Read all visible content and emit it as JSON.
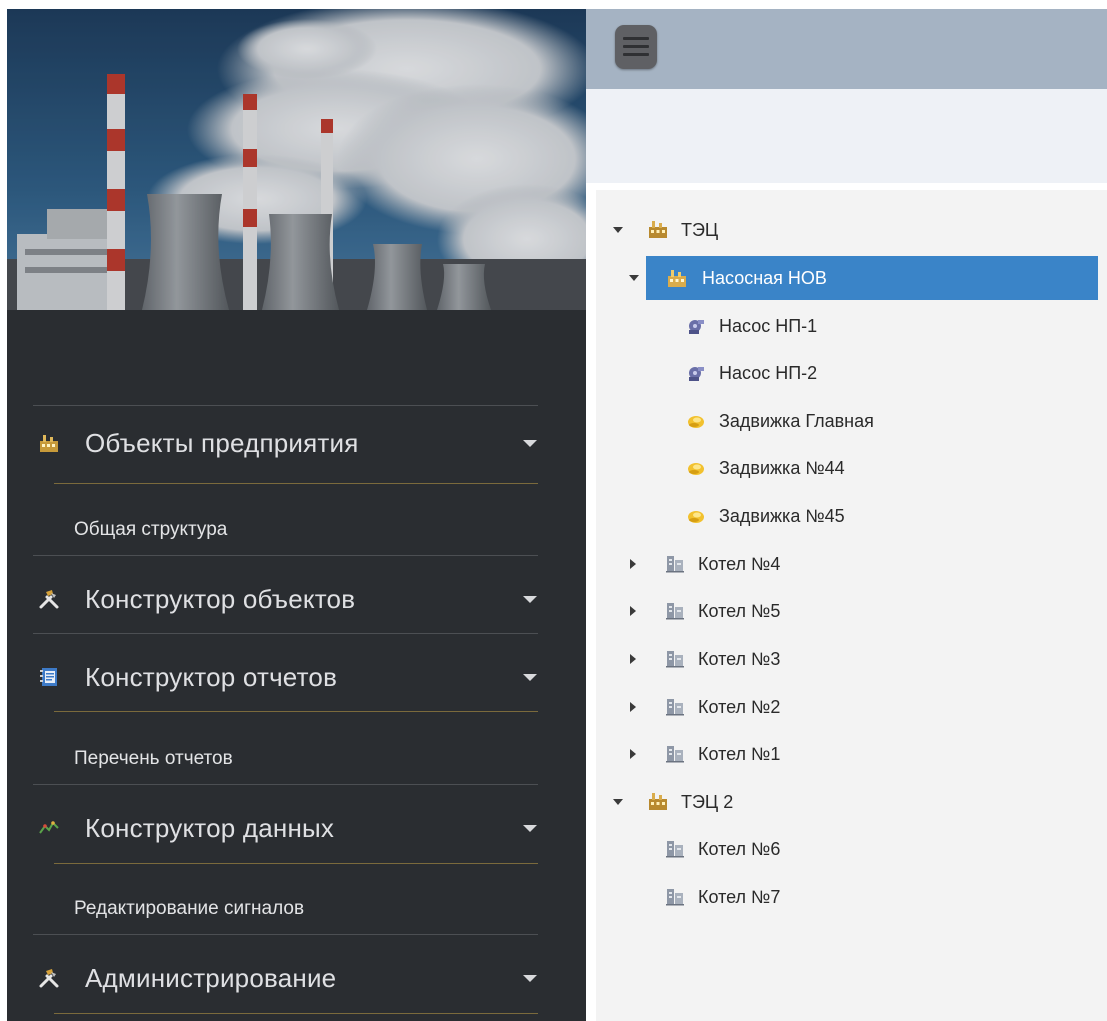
{
  "sidebar": {
    "menu": [
      {
        "label": "Объекты предприятия",
        "icon": "factory-icon",
        "submenu": [
          "Общая структура"
        ]
      },
      {
        "label": "Конструктор объектов",
        "icon": "hammer-icon",
        "submenu": []
      },
      {
        "label": "Конструктор отчетов",
        "icon": "report-book-icon",
        "submenu": [
          "Перечень отчетов"
        ]
      },
      {
        "label": "Конструктор данных",
        "icon": "data-chart-icon",
        "submenu": [
          "Редактирование сигналов"
        ]
      },
      {
        "label": "Администрирование",
        "icon": "hammer-icon",
        "submenu": []
      }
    ]
  },
  "topbar": {
    "menu_icon": "hamburger-icon"
  },
  "tree": {
    "nodes": [
      {
        "label": "ТЭЦ",
        "icon": "factory-icon",
        "state": "expanded",
        "level": 0
      },
      {
        "label": "Насосная НОВ",
        "icon": "factory-icon",
        "state": "expanded",
        "level": 1,
        "selected": true
      },
      {
        "label": "Насос НП-1",
        "icon": "pump-icon",
        "state": "leaf",
        "level": 2
      },
      {
        "label": "Насос НП-2",
        "icon": "pump-icon",
        "state": "leaf",
        "level": 2
      },
      {
        "label": "Задвижка Главная",
        "icon": "valve-icon",
        "state": "leaf",
        "level": 2
      },
      {
        "label": "Задвижка №44",
        "icon": "valve-icon",
        "state": "leaf",
        "level": 2
      },
      {
        "label": "Задвижка №45",
        "icon": "valve-icon",
        "state": "leaf",
        "level": 2
      },
      {
        "label": "Котел №4",
        "icon": "boiler-icon",
        "state": "collapsed",
        "level": 1
      },
      {
        "label": "Котел №5",
        "icon": "boiler-icon",
        "state": "collapsed",
        "level": 1
      },
      {
        "label": "Котел №3",
        "icon": "boiler-icon",
        "state": "collapsed",
        "level": 1
      },
      {
        "label": "Котел №2",
        "icon": "boiler-icon",
        "state": "collapsed",
        "level": 1
      },
      {
        "label": "Котел №1",
        "icon": "boiler-icon",
        "state": "collapsed",
        "level": 1
      },
      {
        "label": "ТЭЦ 2",
        "icon": "factory-icon",
        "state": "expanded",
        "level": 0
      },
      {
        "label": "Котел №6",
        "icon": "boiler-icon",
        "state": "leaf",
        "level": 1
      },
      {
        "label": "Котел №7",
        "icon": "boiler-icon",
        "state": "leaf",
        "level": 1
      }
    ]
  },
  "colors": {
    "sidebar_bg": "#2a2d31",
    "topbar_bg": "#a5b3c3",
    "selected_bg": "#3a84c8",
    "tree_bg": "#f3f3f3"
  }
}
